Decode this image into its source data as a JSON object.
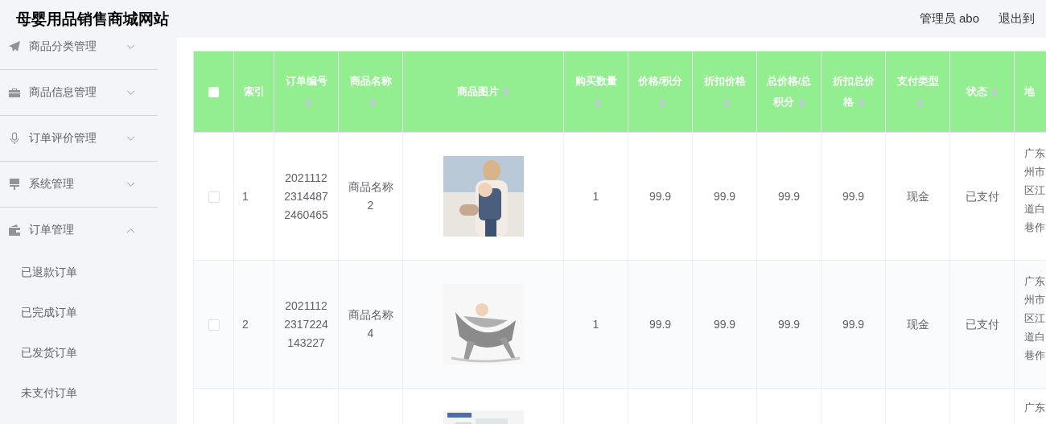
{
  "header": {
    "title": "母婴用品销售商城网站",
    "user": "管理员 abo",
    "logout": "退出到"
  },
  "sidebar": {
    "items": [
      {
        "label": "商品分类管理",
        "expanded": false
      },
      {
        "label": "商品信息管理",
        "expanded": false
      },
      {
        "label": "订单评价管理",
        "expanded": false
      },
      {
        "label": "系统管理",
        "expanded": false
      },
      {
        "label": "订单管理",
        "expanded": true,
        "children": [
          {
            "label": "已退款订单"
          },
          {
            "label": "已完成订单"
          },
          {
            "label": "已发货订单"
          },
          {
            "label": "未支付订单"
          }
        ]
      }
    ]
  },
  "table": {
    "select_all": {
      "checked": false
    },
    "columns": [
      {
        "label": "索引",
        "sortable": false
      },
      {
        "label": "订单编号",
        "sortable": true
      },
      {
        "label": "商品名称",
        "sortable": true
      },
      {
        "label": "商品图片",
        "sortable": true
      },
      {
        "label": "购买数量",
        "sortable": true
      },
      {
        "label": "价格/积分",
        "sortable": true
      },
      {
        "label": "折扣价格",
        "sortable": true
      },
      {
        "label": "总价格/总积分",
        "sortable": true
      },
      {
        "label": "折扣总价格",
        "sortable": true
      },
      {
        "label": "支付类型",
        "sortable": true
      },
      {
        "label": "状态",
        "sortable": true
      },
      {
        "label": "地"
      }
    ],
    "rows": [
      {
        "checked": false,
        "index": "1",
        "order_no": "202111223144872460465",
        "product": "商品名称2",
        "quantity": "1",
        "price": "99.9",
        "discount_price": "99.9",
        "total": "99.9",
        "discount_total": "99.9",
        "payment": "现金",
        "status": "已支付",
        "address": [
          "广东",
          "州市",
          "区江",
          "道白",
          "巷作"
        ]
      },
      {
        "checked": false,
        "index": "2",
        "order_no": "20211122317224143227",
        "product": "商品名称4",
        "quantity": "1",
        "price": "99.9",
        "discount_price": "99.9",
        "total": "99.9",
        "discount_total": "99.9",
        "payment": "现金",
        "status": "已支付",
        "address": [
          "广东",
          "州市",
          "区江",
          "道白",
          "巷作"
        ]
      },
      {
        "address": [
          "广东"
        ]
      }
    ]
  }
}
